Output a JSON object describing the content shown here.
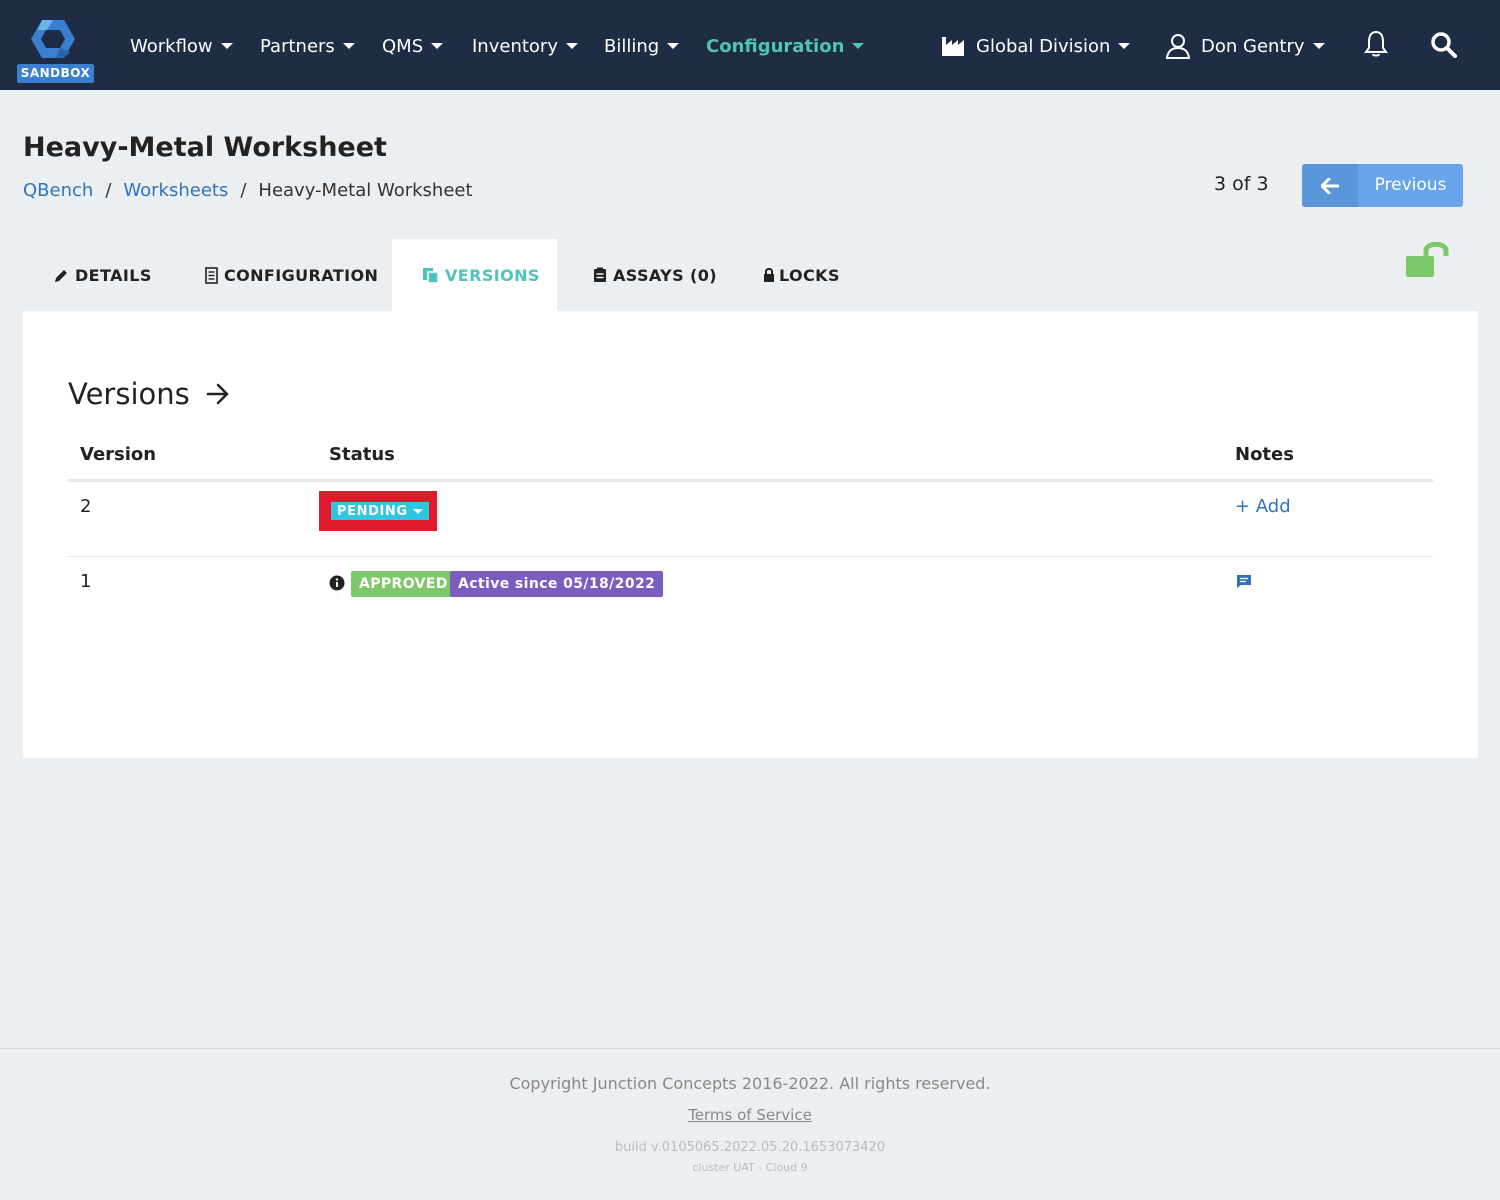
{
  "navbar": {
    "badge": "SANDBOX",
    "items": [
      {
        "label": "Workflow"
      },
      {
        "label": "Partners"
      },
      {
        "label": "QMS"
      },
      {
        "label": "Inventory"
      },
      {
        "label": "Billing"
      },
      {
        "label": "Configuration",
        "active": true
      }
    ],
    "division": "Global Division",
    "user": "Don Gentry",
    "icons": [
      "factory-icon",
      "user-icon",
      "bell-icon",
      "search-icon"
    ],
    "accent_color": "#4fc3b8",
    "background_color": "#1e2d45"
  },
  "header": {
    "title": "Heavy-Metal Worksheet",
    "breadcrumb": [
      "QBench",
      "Worksheets",
      "Heavy-Metal Worksheet"
    ],
    "pager": "3 of 3",
    "previous_label": "Previous"
  },
  "tabs": [
    {
      "label": "DETAILS",
      "icon": "pencil-icon"
    },
    {
      "label": "CONFIGURATION",
      "icon": "document-icon"
    },
    {
      "label": "VERSIONS",
      "icon": "copy-icon",
      "active": true
    },
    {
      "label": "ASSAYS (0)",
      "icon": "clipboard-icon"
    },
    {
      "label": "LOCKS",
      "icon": "lock-icon"
    }
  ],
  "versions": {
    "title": "Versions",
    "columns": [
      "Version",
      "Status",
      "Notes"
    ],
    "rows": [
      {
        "version": "2",
        "status": "PENDING",
        "notes_action": "+ Add"
      },
      {
        "version": "1",
        "status": "APPROVED",
        "active_label": "Active since 05/18/2022",
        "notes_icon": "comment-icon"
      }
    ],
    "colors": {
      "pending": "#2fc6e2",
      "approved": "#7cc86a",
      "active": "#7a5dbe",
      "highlight": "#e0192c"
    }
  },
  "footer": {
    "copyright": "Copyright Junction Concepts 2016-2022. All rights reserved.",
    "terms": "Terms of Service",
    "build": "build v.0105065.2022.05.20.1653073420",
    "cluster": "cluster UAT - Cloud 9"
  }
}
